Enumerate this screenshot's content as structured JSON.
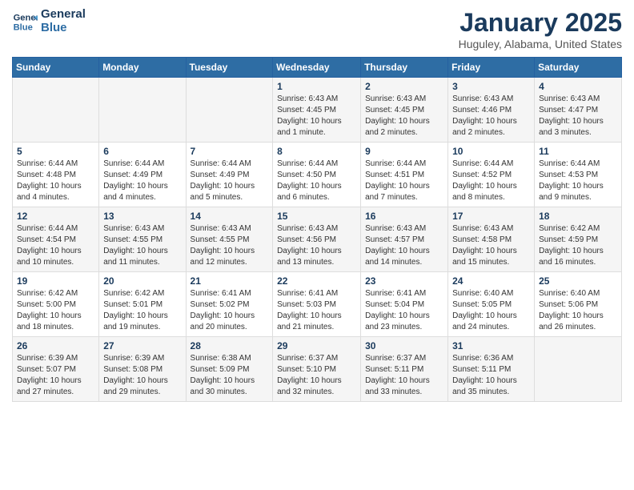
{
  "header": {
    "logo_line1": "General",
    "logo_line2": "Blue",
    "month": "January 2025",
    "location": "Huguley, Alabama, United States"
  },
  "weekdays": [
    "Sunday",
    "Monday",
    "Tuesday",
    "Wednesday",
    "Thursday",
    "Friday",
    "Saturday"
  ],
  "weeks": [
    [
      {
        "day": "",
        "info": ""
      },
      {
        "day": "",
        "info": ""
      },
      {
        "day": "",
        "info": ""
      },
      {
        "day": "1",
        "info": "Sunrise: 6:43 AM\nSunset: 4:45 PM\nDaylight: 10 hours\nand 1 minute."
      },
      {
        "day": "2",
        "info": "Sunrise: 6:43 AM\nSunset: 4:45 PM\nDaylight: 10 hours\nand 2 minutes."
      },
      {
        "day": "3",
        "info": "Sunrise: 6:43 AM\nSunset: 4:46 PM\nDaylight: 10 hours\nand 2 minutes."
      },
      {
        "day": "4",
        "info": "Sunrise: 6:43 AM\nSunset: 4:47 PM\nDaylight: 10 hours\nand 3 minutes."
      }
    ],
    [
      {
        "day": "5",
        "info": "Sunrise: 6:44 AM\nSunset: 4:48 PM\nDaylight: 10 hours\nand 4 minutes."
      },
      {
        "day": "6",
        "info": "Sunrise: 6:44 AM\nSunset: 4:49 PM\nDaylight: 10 hours\nand 4 minutes."
      },
      {
        "day": "7",
        "info": "Sunrise: 6:44 AM\nSunset: 4:49 PM\nDaylight: 10 hours\nand 5 minutes."
      },
      {
        "day": "8",
        "info": "Sunrise: 6:44 AM\nSunset: 4:50 PM\nDaylight: 10 hours\nand 6 minutes."
      },
      {
        "day": "9",
        "info": "Sunrise: 6:44 AM\nSunset: 4:51 PM\nDaylight: 10 hours\nand 7 minutes."
      },
      {
        "day": "10",
        "info": "Sunrise: 6:44 AM\nSunset: 4:52 PM\nDaylight: 10 hours\nand 8 minutes."
      },
      {
        "day": "11",
        "info": "Sunrise: 6:44 AM\nSunset: 4:53 PM\nDaylight: 10 hours\nand 9 minutes."
      }
    ],
    [
      {
        "day": "12",
        "info": "Sunrise: 6:44 AM\nSunset: 4:54 PM\nDaylight: 10 hours\nand 10 minutes."
      },
      {
        "day": "13",
        "info": "Sunrise: 6:43 AM\nSunset: 4:55 PM\nDaylight: 10 hours\nand 11 minutes."
      },
      {
        "day": "14",
        "info": "Sunrise: 6:43 AM\nSunset: 4:55 PM\nDaylight: 10 hours\nand 12 minutes."
      },
      {
        "day": "15",
        "info": "Sunrise: 6:43 AM\nSunset: 4:56 PM\nDaylight: 10 hours\nand 13 minutes."
      },
      {
        "day": "16",
        "info": "Sunrise: 6:43 AM\nSunset: 4:57 PM\nDaylight: 10 hours\nand 14 minutes."
      },
      {
        "day": "17",
        "info": "Sunrise: 6:43 AM\nSunset: 4:58 PM\nDaylight: 10 hours\nand 15 minutes."
      },
      {
        "day": "18",
        "info": "Sunrise: 6:42 AM\nSunset: 4:59 PM\nDaylight: 10 hours\nand 16 minutes."
      }
    ],
    [
      {
        "day": "19",
        "info": "Sunrise: 6:42 AM\nSunset: 5:00 PM\nDaylight: 10 hours\nand 18 minutes."
      },
      {
        "day": "20",
        "info": "Sunrise: 6:42 AM\nSunset: 5:01 PM\nDaylight: 10 hours\nand 19 minutes."
      },
      {
        "day": "21",
        "info": "Sunrise: 6:41 AM\nSunset: 5:02 PM\nDaylight: 10 hours\nand 20 minutes."
      },
      {
        "day": "22",
        "info": "Sunrise: 6:41 AM\nSunset: 5:03 PM\nDaylight: 10 hours\nand 21 minutes."
      },
      {
        "day": "23",
        "info": "Sunrise: 6:41 AM\nSunset: 5:04 PM\nDaylight: 10 hours\nand 23 minutes."
      },
      {
        "day": "24",
        "info": "Sunrise: 6:40 AM\nSunset: 5:05 PM\nDaylight: 10 hours\nand 24 minutes."
      },
      {
        "day": "25",
        "info": "Sunrise: 6:40 AM\nSunset: 5:06 PM\nDaylight: 10 hours\nand 26 minutes."
      }
    ],
    [
      {
        "day": "26",
        "info": "Sunrise: 6:39 AM\nSunset: 5:07 PM\nDaylight: 10 hours\nand 27 minutes."
      },
      {
        "day": "27",
        "info": "Sunrise: 6:39 AM\nSunset: 5:08 PM\nDaylight: 10 hours\nand 29 minutes."
      },
      {
        "day": "28",
        "info": "Sunrise: 6:38 AM\nSunset: 5:09 PM\nDaylight: 10 hours\nand 30 minutes."
      },
      {
        "day": "29",
        "info": "Sunrise: 6:37 AM\nSunset: 5:10 PM\nDaylight: 10 hours\nand 32 minutes."
      },
      {
        "day": "30",
        "info": "Sunrise: 6:37 AM\nSunset: 5:11 PM\nDaylight: 10 hours\nand 33 minutes."
      },
      {
        "day": "31",
        "info": "Sunrise: 6:36 AM\nSunset: 5:11 PM\nDaylight: 10 hours\nand 35 minutes."
      },
      {
        "day": "",
        "info": ""
      }
    ]
  ]
}
